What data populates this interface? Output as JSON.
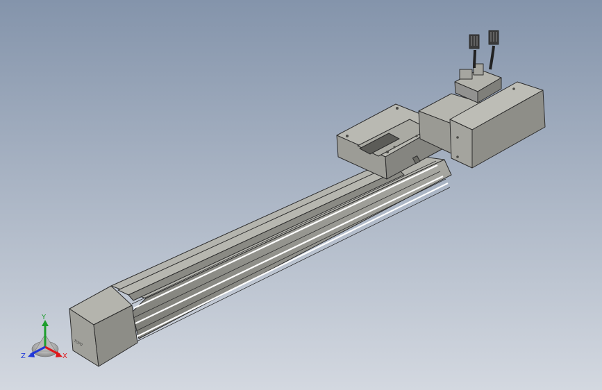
{
  "viewport": {
    "background_top": "#8494ab",
    "background_bottom": "#d3d8e0"
  },
  "model": {
    "body_color": "#a4a49e",
    "body_light": "#c4c4bd",
    "body_dark": "#6f6f69",
    "edge_color": "#2c2c2c",
    "rail_highlight": "#ffffff",
    "end_cap_logo": "TOYO"
  },
  "triad": {
    "x_label": "X",
    "y_label": "Y",
    "z_label": "Z",
    "x_color": "#e0161a",
    "y_color": "#1d9e2c",
    "z_color": "#2038d8"
  }
}
